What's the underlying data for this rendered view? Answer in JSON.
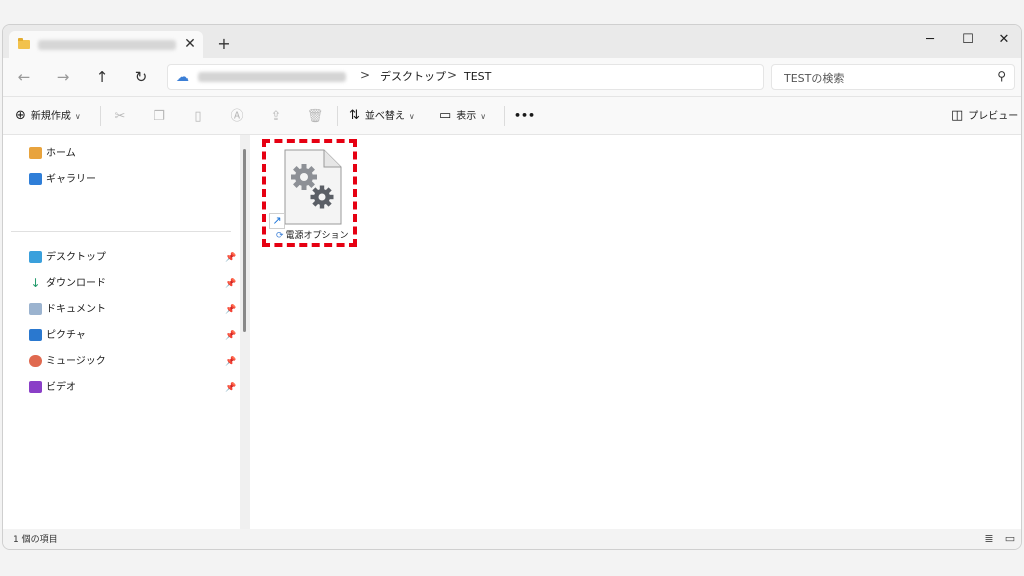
{
  "titlebar": {
    "tab_close": "✕",
    "new_tab": "+",
    "minimize": "─",
    "maximize": "☐",
    "close": "✕"
  },
  "address": {
    "back": "←",
    "forward": "→",
    "up": "↑",
    "refresh": "↻",
    "crumbs": [
      "デスクトップ",
      "TEST"
    ],
    "separator": ">"
  },
  "search": {
    "placeholder": "TESTの検索"
  },
  "toolbar": {
    "new_label": "新規作成",
    "sort_label": "並べ替え",
    "view_label": "表示",
    "more_label": "•••",
    "preview_label": "プレビュー"
  },
  "nav": {
    "top_items": [
      {
        "label": "ホーム",
        "icon": "home-icon"
      },
      {
        "label": "ギャラリー",
        "icon": "gallery-icon"
      }
    ],
    "pinned_items": [
      {
        "label": "デスクトップ",
        "icon": "desktop-icon"
      },
      {
        "label": "ダウンロード",
        "icon": "download-icon"
      },
      {
        "label": "ドキュメント",
        "icon": "document-icon"
      },
      {
        "label": "ピクチャ",
        "icon": "pictures-icon"
      },
      {
        "label": "ミュージック",
        "icon": "music-icon"
      },
      {
        "label": "ビデオ",
        "icon": "video-icon"
      }
    ]
  },
  "content": {
    "files": [
      {
        "name": "電源オプション",
        "icon": "settings-shortcut-icon"
      }
    ]
  },
  "status": {
    "item_count": "1 個の項目"
  },
  "colors": {
    "highlight": "#e60012",
    "accent": "#3c7fd6"
  }
}
